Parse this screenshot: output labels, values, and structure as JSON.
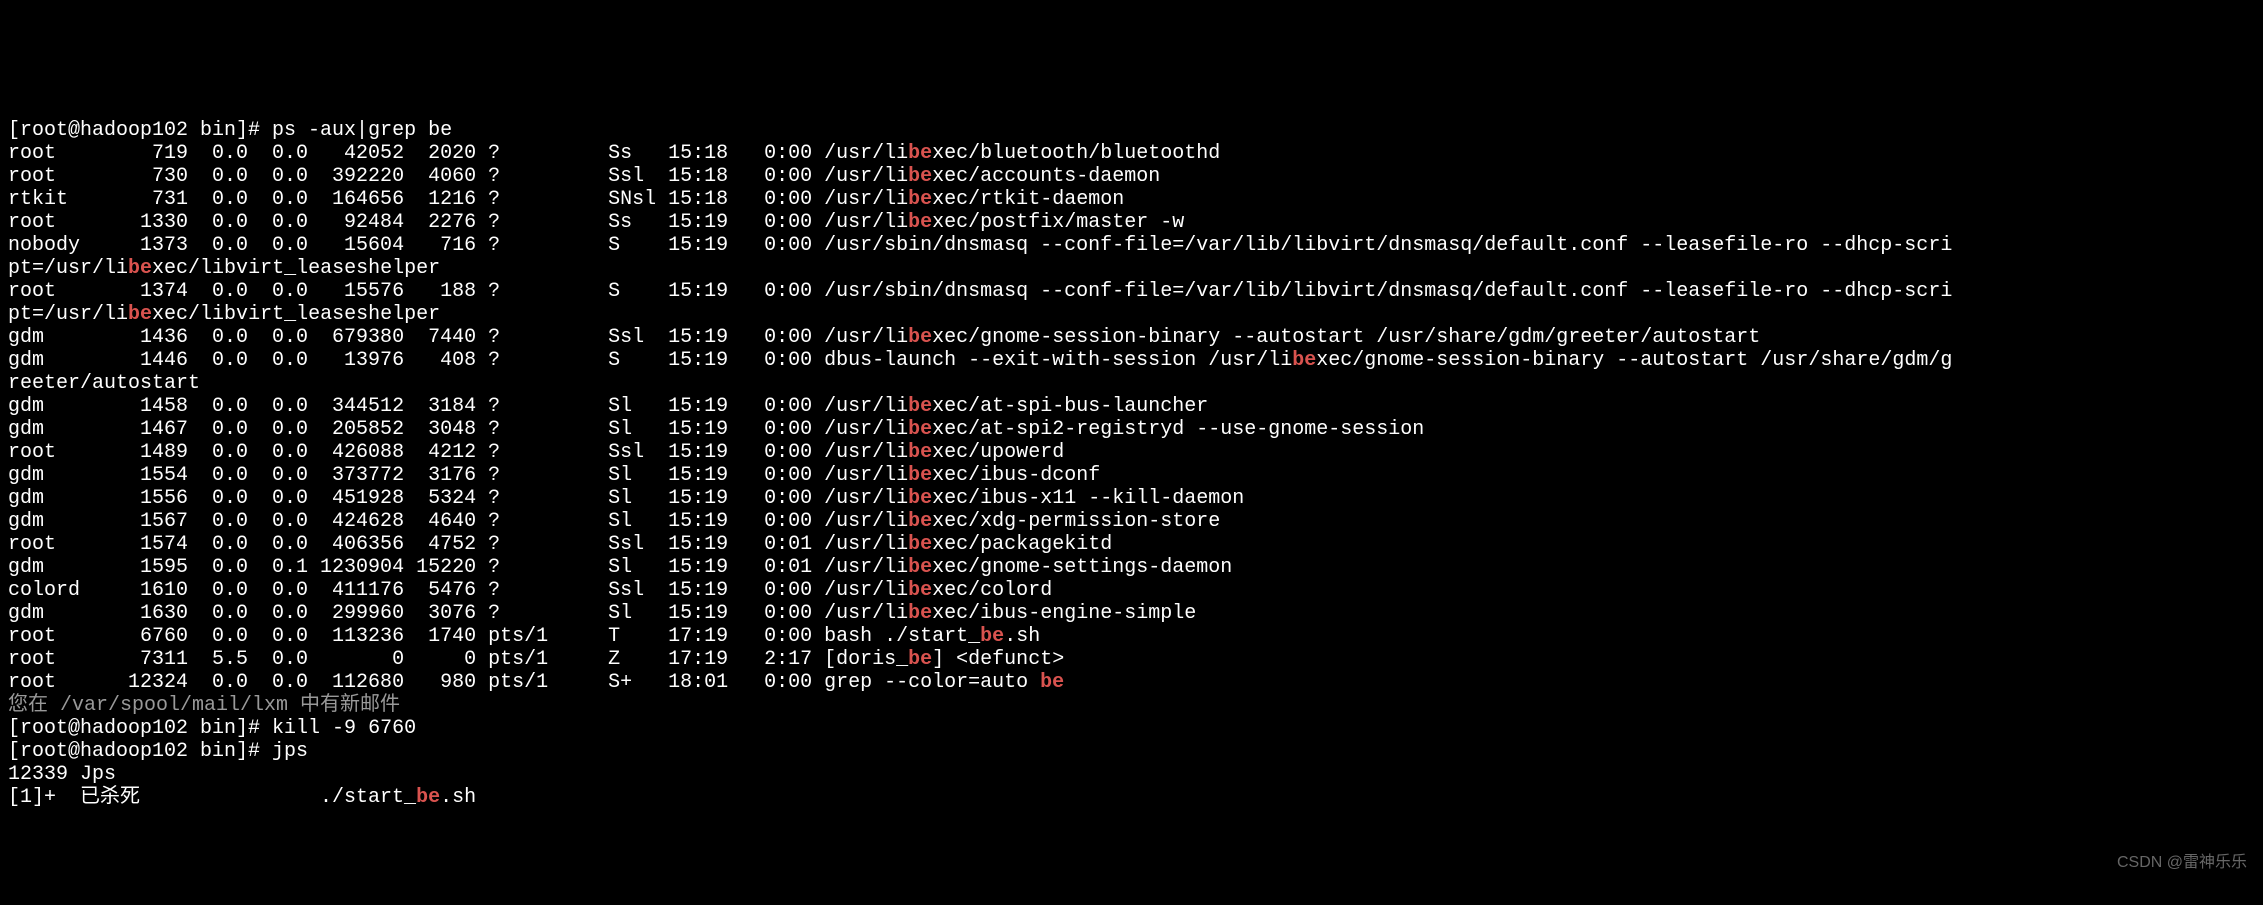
{
  "prompt_host": "[root@hadoop102 bin]# ",
  "cmd1": "ps -aux|grep be",
  "rows": [
    {
      "user": "root",
      "pid": "719",
      "cpu": "0.0",
      "mem": "0.0",
      "vsz": "42052",
      "rss": "2020",
      "tty": "?",
      "stat": "Ss",
      "start": "15:18",
      "time": "0:00",
      "cmd_pre": "/usr/li",
      "cmd_post": "xec/bluetooth/bluetoothd",
      "wrap": ""
    },
    {
      "user": "root",
      "pid": "730",
      "cpu": "0.0",
      "mem": "0.0",
      "vsz": "392220",
      "rss": "4060",
      "tty": "?",
      "stat": "Ssl",
      "start": "15:18",
      "time": "0:00",
      "cmd_pre": "/usr/li",
      "cmd_post": "xec/accounts-daemon",
      "wrap": ""
    },
    {
      "user": "rtkit",
      "pid": "731",
      "cpu": "0.0",
      "mem": "0.0",
      "vsz": "164656",
      "rss": "1216",
      "tty": "?",
      "stat": "SNsl",
      "start": "15:18",
      "time": "0:00",
      "cmd_pre": "/usr/li",
      "cmd_post": "xec/rtkit-daemon",
      "wrap": ""
    },
    {
      "user": "root",
      "pid": "1330",
      "cpu": "0.0",
      "mem": "0.0",
      "vsz": "92484",
      "rss": "2276",
      "tty": "?",
      "stat": "Ss",
      "start": "15:19",
      "time": "0:00",
      "cmd_pre": "/usr/li",
      "cmd_post": "xec/postfix/master -w",
      "wrap": ""
    },
    {
      "user": "nobody",
      "pid": "1373",
      "cpu": "0.0",
      "mem": "0.0",
      "vsz": "15604",
      "rss": "716",
      "tty": "?",
      "stat": "S",
      "start": "15:19",
      "time": "0:00",
      "cmd_pre": "",
      "cmd_post": "/usr/sbin/dnsmasq --conf-file=/var/lib/libvirt/dnsmasq/default.conf --leasefile-ro --dhcp-scri",
      "wrap": "pt=/usr/li|be|xec/libvirt_leaseshelper"
    },
    {
      "user": "root",
      "pid": "1374",
      "cpu": "0.0",
      "mem": "0.0",
      "vsz": "15576",
      "rss": "188",
      "tty": "?",
      "stat": "S",
      "start": "15:19",
      "time": "0:00",
      "cmd_pre": "",
      "cmd_post": "/usr/sbin/dnsmasq --conf-file=/var/lib/libvirt/dnsmasq/default.conf --leasefile-ro --dhcp-scri",
      "wrap": "pt=/usr/li|be|xec/libvirt_leaseshelper"
    },
    {
      "user": "gdm",
      "pid": "1436",
      "cpu": "0.0",
      "mem": "0.0",
      "vsz": "679380",
      "rss": "7440",
      "tty": "?",
      "stat": "Ssl",
      "start": "15:19",
      "time": "0:00",
      "cmd_pre": "/usr/li",
      "cmd_post": "xec/gnome-session-binary --autostart /usr/share/gdm/greeter/autostart",
      "wrap": ""
    },
    {
      "user": "gdm",
      "pid": "1446",
      "cpu": "0.0",
      "mem": "0.0",
      "vsz": "13976",
      "rss": "408",
      "tty": "?",
      "stat": "S",
      "start": "15:19",
      "time": "0:00",
      "cmd_pre": "",
      "cmd_post": "dbus-launch --exit-with-session /usr/li|be|xec/gnome-session-binary --autostart /usr/share/gdm/g",
      "wrap": "reeter/autostart"
    },
    {
      "user": "gdm",
      "pid": "1458",
      "cpu": "0.0",
      "mem": "0.0",
      "vsz": "344512",
      "rss": "3184",
      "tty": "?",
      "stat": "Sl",
      "start": "15:19",
      "time": "0:00",
      "cmd_pre": "/usr/li",
      "cmd_post": "xec/at-spi-bus-launcher",
      "wrap": ""
    },
    {
      "user": "gdm",
      "pid": "1467",
      "cpu": "0.0",
      "mem": "0.0",
      "vsz": "205852",
      "rss": "3048",
      "tty": "?",
      "stat": "Sl",
      "start": "15:19",
      "time": "0:00",
      "cmd_pre": "/usr/li",
      "cmd_post": "xec/at-spi2-registryd --use-gnome-session",
      "wrap": ""
    },
    {
      "user": "root",
      "pid": "1489",
      "cpu": "0.0",
      "mem": "0.0",
      "vsz": "426088",
      "rss": "4212",
      "tty": "?",
      "stat": "Ssl",
      "start": "15:19",
      "time": "0:00",
      "cmd_pre": "/usr/li",
      "cmd_post": "xec/upowerd",
      "wrap": ""
    },
    {
      "user": "gdm",
      "pid": "1554",
      "cpu": "0.0",
      "mem": "0.0",
      "vsz": "373772",
      "rss": "3176",
      "tty": "?",
      "stat": "Sl",
      "start": "15:19",
      "time": "0:00",
      "cmd_pre": "/usr/li",
      "cmd_post": "xec/ibus-dconf",
      "wrap": ""
    },
    {
      "user": "gdm",
      "pid": "1556",
      "cpu": "0.0",
      "mem": "0.0",
      "vsz": "451928",
      "rss": "5324",
      "tty": "?",
      "stat": "Sl",
      "start": "15:19",
      "time": "0:00",
      "cmd_pre": "/usr/li",
      "cmd_post": "xec/ibus-x11 --kill-daemon",
      "wrap": ""
    },
    {
      "user": "gdm",
      "pid": "1567",
      "cpu": "0.0",
      "mem": "0.0",
      "vsz": "424628",
      "rss": "4640",
      "tty": "?",
      "stat": "Sl",
      "start": "15:19",
      "time": "0:00",
      "cmd_pre": "/usr/li",
      "cmd_post": "xec/xdg-permission-store",
      "wrap": ""
    },
    {
      "user": "root",
      "pid": "1574",
      "cpu": "0.0",
      "mem": "0.0",
      "vsz": "406356",
      "rss": "4752",
      "tty": "?",
      "stat": "Ssl",
      "start": "15:19",
      "time": "0:01",
      "cmd_pre": "/usr/li",
      "cmd_post": "xec/packagekitd",
      "wrap": ""
    },
    {
      "user": "gdm",
      "pid": "1595",
      "cpu": "0.0",
      "mem": "0.1",
      "vsz": "1230904",
      "rss": "15220",
      "tty": "?",
      "stat": "Sl",
      "start": "15:19",
      "time": "0:01",
      "cmd_pre": "/usr/li",
      "cmd_post": "xec/gnome-settings-daemon",
      "wrap": ""
    },
    {
      "user": "colord",
      "pid": "1610",
      "cpu": "0.0",
      "mem": "0.0",
      "vsz": "411176",
      "rss": "5476",
      "tty": "?",
      "stat": "Ssl",
      "start": "15:19",
      "time": "0:00",
      "cmd_pre": "/usr/li",
      "cmd_post": "xec/colord",
      "wrap": ""
    },
    {
      "user": "gdm",
      "pid": "1630",
      "cpu": "0.0",
      "mem": "0.0",
      "vsz": "299960",
      "rss": "3076",
      "tty": "?",
      "stat": "Sl",
      "start": "15:19",
      "time": "0:00",
      "cmd_pre": "/usr/li",
      "cmd_post": "xec/ibus-engine-simple",
      "wrap": ""
    },
    {
      "user": "root",
      "pid": "6760",
      "cpu": "0.0",
      "mem": "0.0",
      "vsz": "113236",
      "rss": "1740",
      "tty": "pts/1",
      "stat": "T",
      "start": "17:19",
      "time": "0:00",
      "cmd_pre": "",
      "cmd_post": "bash ./start_|be|.sh",
      "wrap": ""
    },
    {
      "user": "root",
      "pid": "7311",
      "cpu": "5.5",
      "mem": "0.0",
      "vsz": "0",
      "rss": "0",
      "tty": "pts/1",
      "stat": "Z",
      "start": "17:19",
      "time": "2:17",
      "cmd_pre": "",
      "cmd_post": "[doris_|be|] <defunct>",
      "wrap": ""
    },
    {
      "user": "root",
      "pid": "12324",
      "cpu": "0.0",
      "mem": "0.0",
      "vsz": "112680",
      "rss": "980",
      "tty": "pts/1",
      "stat": "S+",
      "start": "18:01",
      "time": "0:00",
      "cmd_pre": "",
      "cmd_post": "grep --color=auto |be|",
      "wrap": ""
    }
  ],
  "mail_msg": "您在 /var/spool/mail/lxm 中有新邮件",
  "cmd2": "kill -9 6760",
  "cmd3": "jps",
  "jps_out": "12339 Jps",
  "job_line_pre": "[1]+  已杀死               ./start_",
  "job_line_post": ".sh",
  "watermark": "CSDN @雷神乐乐"
}
